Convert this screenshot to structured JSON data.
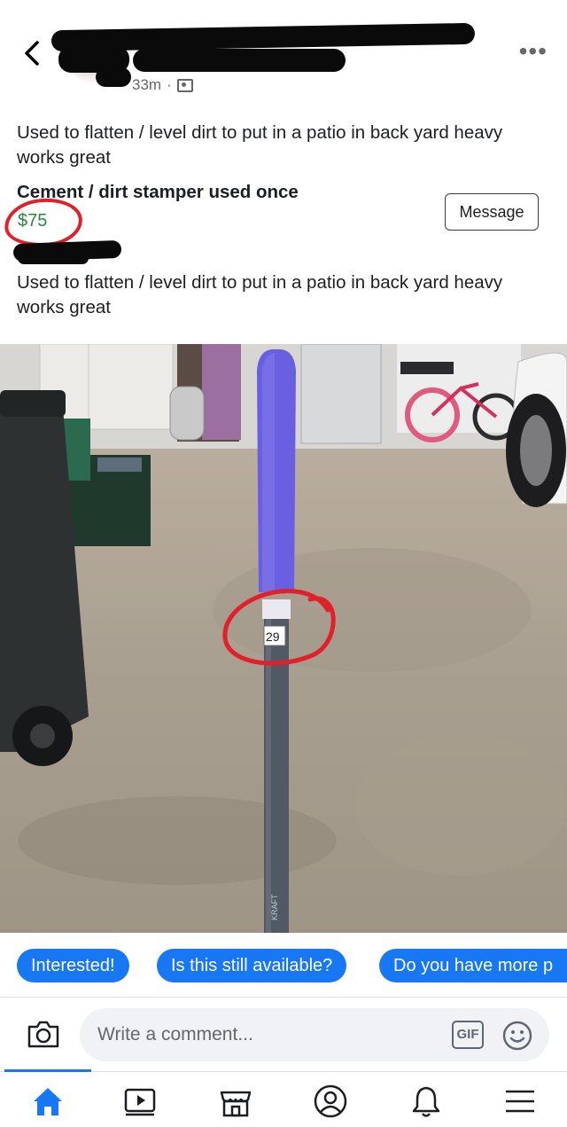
{
  "header": {
    "time": "33m",
    "separator": "·",
    "back_icon": "chevron-left-icon",
    "more_icon": "more-horizontal-icon",
    "visibility_icon": "friends-icon"
  },
  "post": {
    "description": "Used to flatten / level dirt to put in a patio in back yard heavy works great",
    "title": "Cement / dirt stamper used once",
    "price": "$75",
    "message_label": "Message",
    "description_repeat": "Used to flatten / level dirt to put in a patio in back yard heavy works great"
  },
  "photo": {
    "price_tag": "29",
    "handle_brand": "KRAFT"
  },
  "quick_replies": [
    {
      "label": "Interested!"
    },
    {
      "label": "Is this still available?"
    },
    {
      "label": "Do you have more p"
    }
  ],
  "comment": {
    "placeholder": "Write a comment...",
    "gif_label": "GIF"
  },
  "nav": {
    "items": [
      "home-icon",
      "video-icon",
      "marketplace-icon",
      "profile-icon",
      "notifications-icon",
      "menu-icon"
    ],
    "active": "home-icon"
  },
  "colors": {
    "accent": "#1877f2",
    "price_green": "#2b8a3e",
    "annotation_red": "#e0202a",
    "tamper_blue": "#6a5fe0"
  }
}
